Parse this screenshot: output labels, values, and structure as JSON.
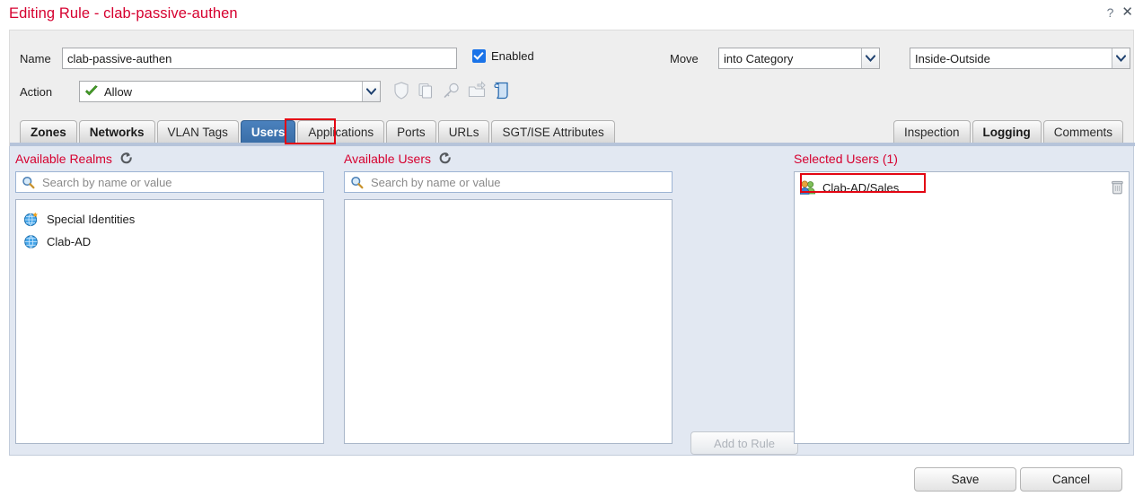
{
  "window": {
    "title": "Editing Rule - clab-passive-authen",
    "help_icon": "?",
    "close_icon": "✕"
  },
  "rule": {
    "name_label": "Name",
    "name_value": "clab-passive-authen",
    "enabled_label": "Enabled",
    "enabled_checked": true,
    "action_label": "Action",
    "action_value": "Allow",
    "action_icon": "green-check-icon",
    "move_label": "Move",
    "move_value": "into Category",
    "category_value": "Inside-Outside",
    "inline_icons": [
      {
        "name": "ips-policy-shield-icon",
        "enabled": false
      },
      {
        "name": "file-policy-copy-icon",
        "enabled": false
      },
      {
        "name": "ssl-decryption-key-icon",
        "enabled": false
      },
      {
        "name": "safe-search-folder-icon",
        "enabled": false
      },
      {
        "name": "logging-scroll-icon",
        "enabled": true
      }
    ]
  },
  "tabs": {
    "left": [
      {
        "label": "Zones",
        "bold": true,
        "active": false
      },
      {
        "label": "Networks",
        "bold": true,
        "active": false
      },
      {
        "label": "VLAN Tags",
        "bold": false,
        "active": false
      },
      {
        "label": "Users",
        "bold": false,
        "active": true,
        "highlighted": true
      },
      {
        "label": "Applications",
        "bold": false,
        "active": false
      },
      {
        "label": "Ports",
        "bold": false,
        "active": false
      },
      {
        "label": "URLs",
        "bold": false,
        "active": false
      },
      {
        "label": "SGT/ISE Attributes",
        "bold": false,
        "active": false
      }
    ],
    "right": [
      {
        "label": "Inspection",
        "bold": false,
        "active": false
      },
      {
        "label": "Logging",
        "bold": true,
        "active": false
      },
      {
        "label": "Comments",
        "bold": false,
        "active": false
      }
    ]
  },
  "panels": {
    "realms": {
      "header": "Available Realms",
      "refresh_icon": "refresh-icon",
      "search_placeholder": "Search by name or value",
      "search_value": "",
      "items": [
        {
          "label": "Special Identities",
          "icon": "globe-star-icon"
        },
        {
          "label": "Clab-AD",
          "icon": "globe-icon"
        }
      ]
    },
    "users": {
      "header": "Available Users",
      "refresh_icon": "refresh-icon",
      "search_placeholder": "Search by name or value",
      "search_value": "",
      "items": []
    },
    "selected": {
      "header": "Selected Users (1)",
      "items": [
        {
          "label": "Clab-AD/Sales",
          "icon": "user-group-icon",
          "delete_icon": "trash-icon",
          "highlighted": true
        }
      ]
    },
    "add_button": "Add to Rule"
  },
  "footer": {
    "save": "Save",
    "cancel": "Cancel"
  },
  "colors": {
    "title_red": "#d6002f",
    "header_red": "#d6002f",
    "annotation_red": "#e30613",
    "active_tab_blue": "#3f78b8",
    "checkbox_blue": "#1a73e8",
    "panel_bg": "#e2e8f2"
  }
}
